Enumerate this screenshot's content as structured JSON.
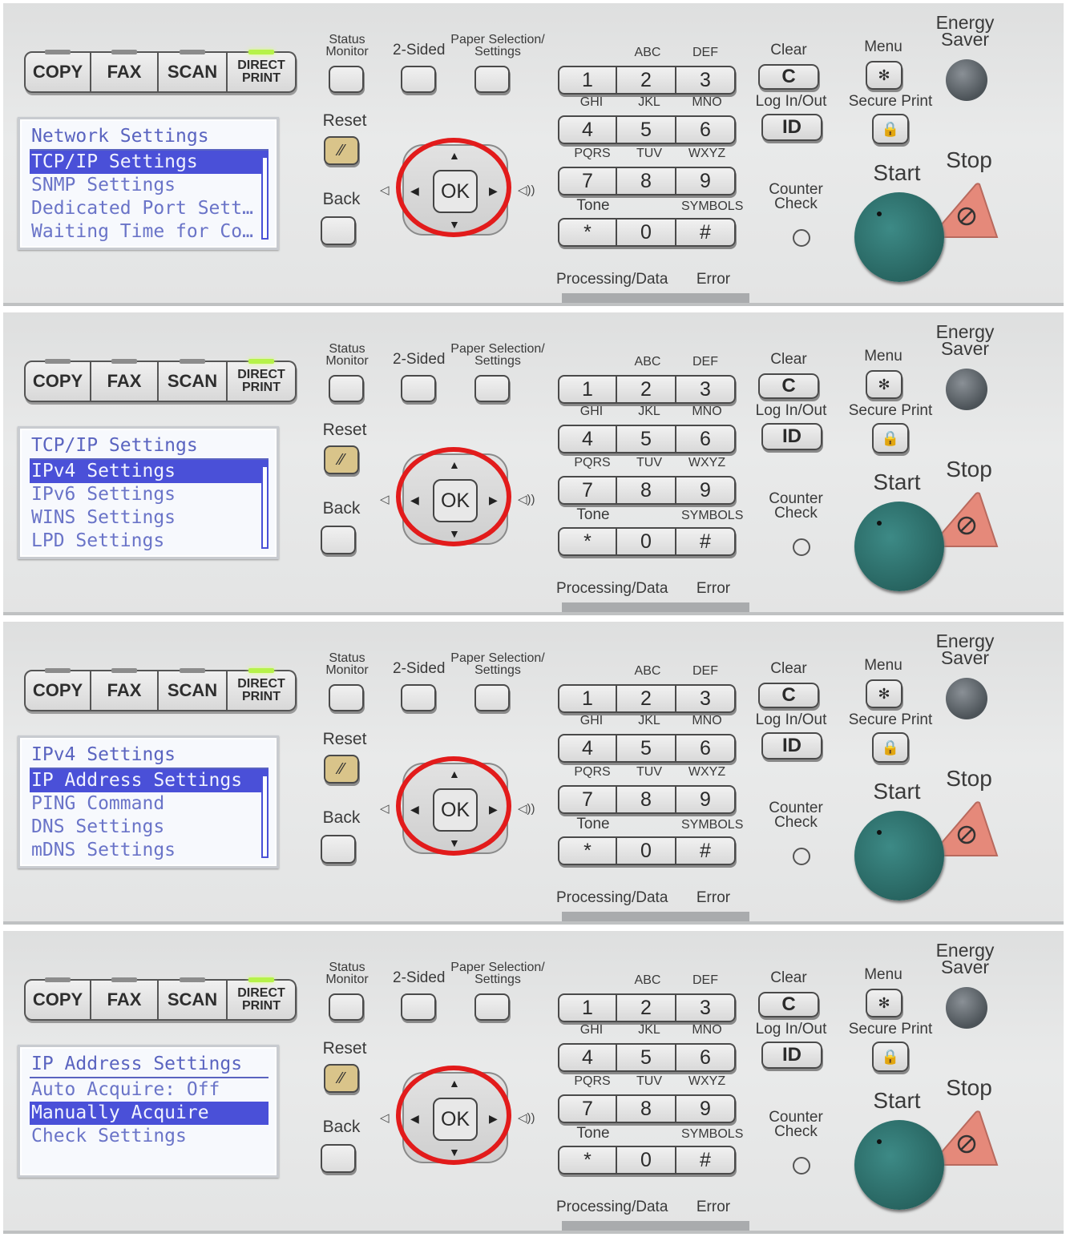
{
  "panel": {
    "modes": [
      "COPY",
      "FAX",
      "SCAN"
    ],
    "direct_print": [
      "DIRECT",
      "PRINT"
    ],
    "status_monitor": [
      "Status",
      "Monitor"
    ],
    "two_sided": "2-Sided",
    "paper_selection": [
      "Paper Selection/",
      "Settings"
    ],
    "reset": "Reset",
    "back": "Back",
    "ok": "OK",
    "keypad_top_letters": [
      "ABC",
      "DEF"
    ],
    "keypad_rows": [
      [
        "1",
        "2",
        "3"
      ],
      [
        "4",
        "5",
        "6"
      ],
      [
        "7",
        "8",
        "9"
      ],
      [
        "*",
        "0",
        "#"
      ]
    ],
    "keypad_letters_row2": [
      "GHI",
      "JKL",
      "MNO"
    ],
    "keypad_letters_row3": [
      "PQRS",
      "TUV",
      "WXYZ"
    ],
    "tone": "Tone",
    "symbols": "SYMBOLS",
    "clear": "Clear",
    "clear_key": "C",
    "log_in_out": "Log In/Out",
    "id_key": "ID",
    "counter_check": [
      "Counter",
      "Check"
    ],
    "menu": "Menu",
    "secure_print": "Secure Print",
    "energy_saver": [
      "Energy",
      "Saver"
    ],
    "start": "Start",
    "stop": "Stop",
    "processing_data": "Processing/Data",
    "error": "Error",
    "highlight_color": "#e21b1b"
  },
  "screens": [
    {
      "title": "Network Settings",
      "items": [
        "TCP/IP Settings",
        "SNMP Settings",
        "Dedicated Port Sett…",
        "Waiting Time for Co…"
      ],
      "selected": 0
    },
    {
      "title": "TCP/IP Settings",
      "items": [
        "IPv4 Settings",
        "IPv6 Settings",
        "WINS Settings",
        "LPD Settings"
      ],
      "selected": 0
    },
    {
      "title": "IPv4 Settings",
      "items": [
        "IP Address Settings",
        "PING Command",
        "DNS Settings",
        "mDNS Settings"
      ],
      "selected": 0
    },
    {
      "title": "IP Address Settings",
      "items": [
        "Auto Acquire: Off",
        "Manually Acquire",
        "Check Settings"
      ],
      "selected": 1
    }
  ]
}
